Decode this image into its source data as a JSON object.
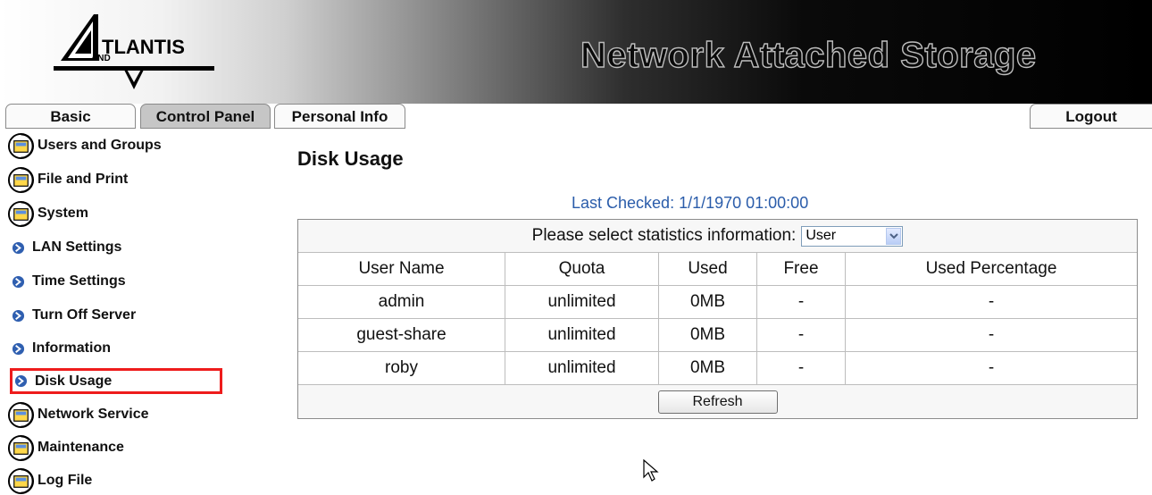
{
  "header": {
    "logo_text": "ATLANTIS LAND",
    "title": "Network Attached Storage"
  },
  "tabs": [
    {
      "label": "Basic",
      "active": false
    },
    {
      "label": "Control Panel",
      "active": true
    },
    {
      "label": "Personal Info",
      "active": false
    }
  ],
  "logout_label": "Logout",
  "sidebar": {
    "items": [
      {
        "label": "Users and Groups",
        "type": "group",
        "icon": "folder-globe-icon"
      },
      {
        "label": "File and Print",
        "type": "group",
        "icon": "folder-globe-icon"
      },
      {
        "label": "System",
        "type": "group",
        "icon": "folder-globe-icon"
      },
      {
        "label": "LAN Settings",
        "type": "sub",
        "icon": "blue-bullet-icon"
      },
      {
        "label": "Time Settings",
        "type": "sub",
        "icon": "blue-bullet-icon"
      },
      {
        "label": "Turn Off Server",
        "type": "sub",
        "icon": "blue-bullet-icon"
      },
      {
        "label": "Information",
        "type": "sub",
        "icon": "blue-bullet-icon"
      },
      {
        "label": "Disk Usage",
        "type": "sub",
        "icon": "blue-bullet-icon",
        "selected": true
      },
      {
        "label": "Network Service",
        "type": "group",
        "icon": "folder-globe-icon"
      },
      {
        "label": "Maintenance",
        "type": "group",
        "icon": "folder-globe-icon"
      },
      {
        "label": "Log File",
        "type": "group",
        "icon": "folder-globe-icon"
      }
    ]
  },
  "main": {
    "title": "Disk Usage",
    "last_checked": "Last Checked: 1/1/1970 01:00:00",
    "select_label": "Please select statistics information:",
    "select_value": "User",
    "columns": [
      "User Name",
      "Quota",
      "Used",
      "Free",
      "Used Percentage"
    ],
    "rows": [
      [
        "admin",
        "unlimited",
        "0MB",
        "-",
        "-"
      ],
      [
        "guest-share",
        "unlimited",
        "0MB",
        "-",
        "-"
      ],
      [
        "roby",
        "unlimited",
        "0MB",
        "-",
        "-"
      ]
    ],
    "refresh_label": "Refresh"
  },
  "colors": {
    "accent_blue": "#2a5caa",
    "selection_border": "#ee1c1c"
  }
}
